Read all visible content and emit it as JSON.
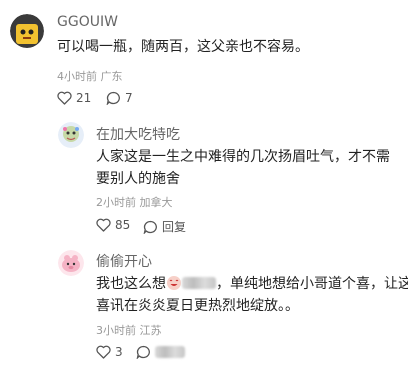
{
  "comment1": {
    "username": "GGOUIW",
    "text": "可以喝一瓶，随两百，这父亲也不容易。",
    "time": "4小时前",
    "location": "广东",
    "likes": "21",
    "replies": "7"
  },
  "reply1": {
    "username": "在加大吃特吃",
    "text_line1": "人家这是一生之中难得的几次扬眉吐气，才不需",
    "text_line2": "要别人的施舍",
    "time": "2小时前",
    "location": "加拿大",
    "likes": "85",
    "reply_label": "回复"
  },
  "reply2": {
    "username": "偷偷开心",
    "text_part1": "我也这么想",
    "text_part2": "，单纯地想给小哥道个喜，让这个",
    "text_line2": "喜讯在炎炎夏日更热烈地绽放。。",
    "time": "3小时前",
    "location": "江苏",
    "likes": "3"
  }
}
